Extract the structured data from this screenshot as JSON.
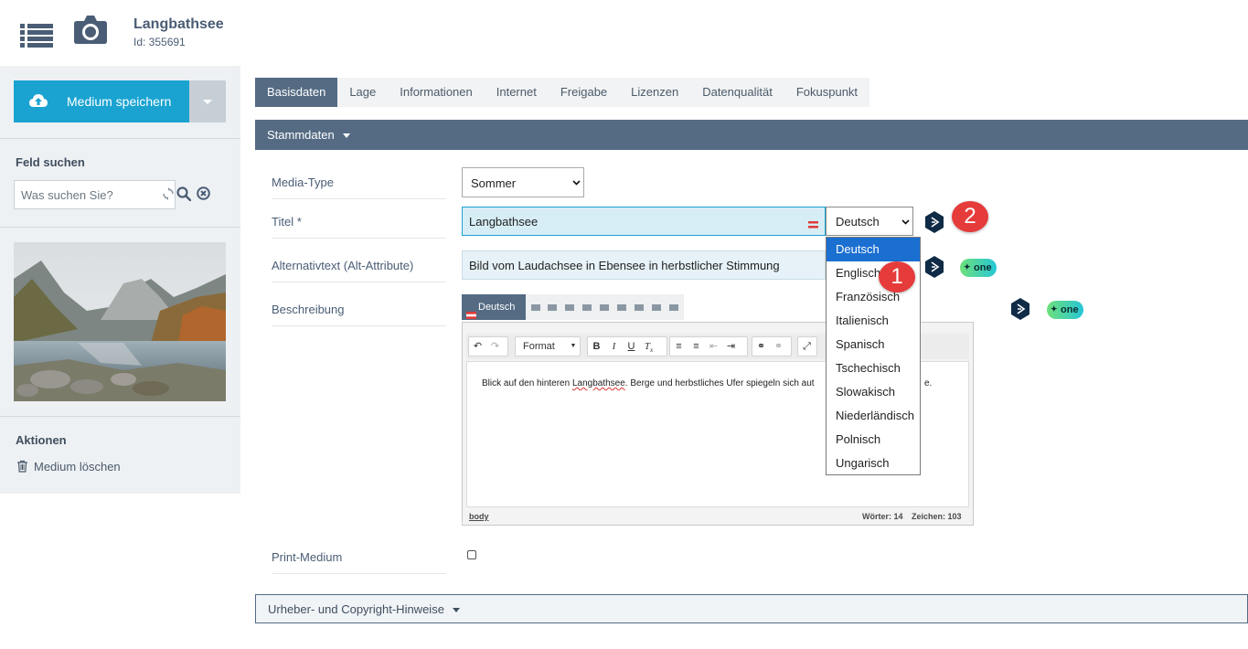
{
  "header": {
    "title": "Langbathsee",
    "id_text": "Id: 355691"
  },
  "sidebar": {
    "save_label": "Medium speichern",
    "search_heading": "Feld suchen",
    "search_placeholder": "Was suchen Sie?",
    "actions_heading": "Aktionen",
    "delete_label": "Medium löschen"
  },
  "tabs": [
    {
      "label": "Basisdaten",
      "active": true
    },
    {
      "label": "Lage"
    },
    {
      "label": "Informationen"
    },
    {
      "label": "Internet"
    },
    {
      "label": "Freigabe"
    },
    {
      "label": "Lizenzen"
    },
    {
      "label": "Datenqualität"
    },
    {
      "label": "Fokuspunkt"
    }
  ],
  "sections": {
    "stammdaten": "Stammdaten",
    "urheber": "Urheber- und Copyright-Hinweise"
  },
  "form": {
    "media_type_label": "Media-Type",
    "media_type_value": "Sommer",
    "title_label": "Titel *",
    "title_value": "Langbathsee",
    "title_language": "Deutsch",
    "alt_label": "Alternativtext (Alt-Attribute)",
    "alt_value": "Bild vom Laudachsee in Ebensee in herbstlicher Stimmung",
    "description_label": "Beschreibung",
    "print_label": "Print-Medium",
    "one_label": "one"
  },
  "editor": {
    "lang_tab": "Deutsch",
    "format_label": "Format",
    "text_before": "Blick auf den hinteren ",
    "text_misspelled": "Langbathsee",
    "text_after": ". Berge und herbstliches Ufer spiegeln sich aut",
    "text_tail": "e.",
    "status_path": "body",
    "status_words": "Wörter: 14",
    "status_chars": "Zeichen: 103"
  },
  "language_dropdown": {
    "options": [
      "Deutsch",
      "Englisch",
      "Französisch",
      "Italienisch",
      "Spanisch",
      "Tschechisch",
      "Slowakisch",
      "Niederländisch",
      "Polnisch",
      "Ungarisch"
    ],
    "selected": "Deutsch"
  },
  "annotations": {
    "badge_1": "1",
    "badge_2": "2"
  },
  "colors": {
    "accent": "#1aa3d1",
    "nav_dark": "#546b83",
    "badge_red": "#e63b3b",
    "dropdown_selected": "#1a6fd1"
  }
}
